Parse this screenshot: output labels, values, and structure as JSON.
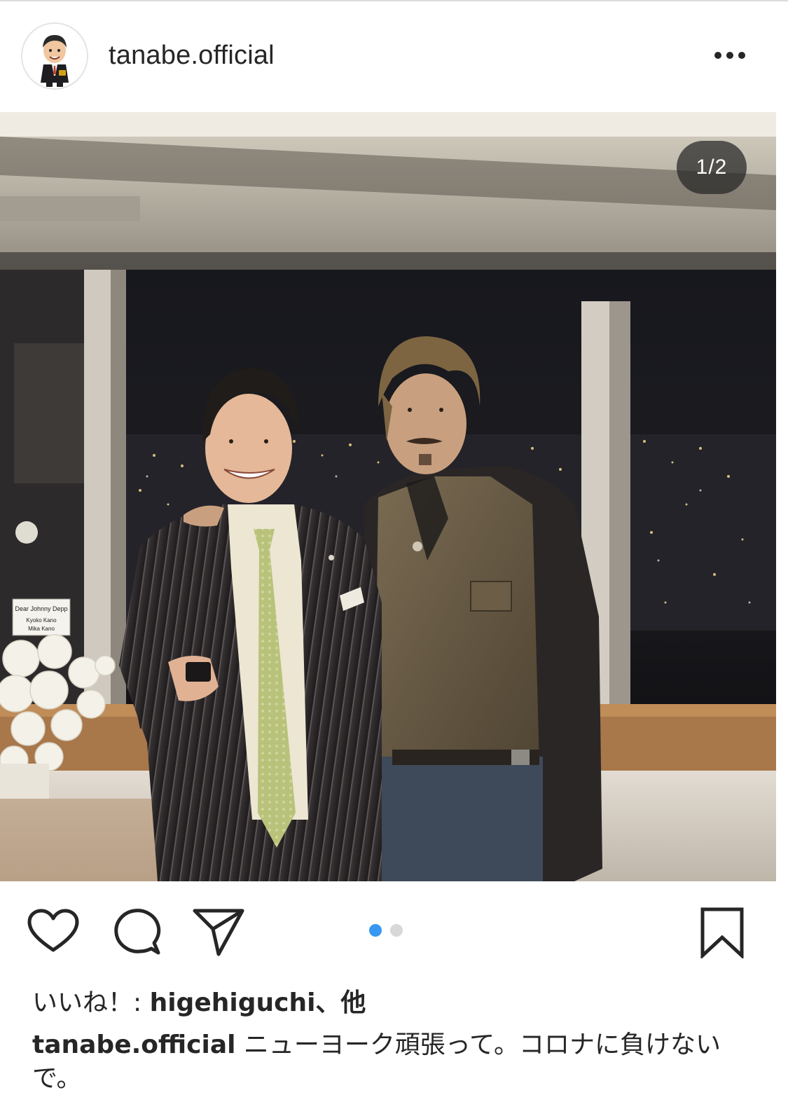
{
  "header": {
    "username": "tanabe.official",
    "avatar_icon": "cartoon-avatar-icon",
    "more_icon": "more-options-icon"
  },
  "photo": {
    "counter": "1/2",
    "card_lines": [
      "Dear Johnny Depp",
      "Kyoko Kano",
      "Mika Kano"
    ]
  },
  "actions": {
    "like_icon": "heart-icon",
    "comment_icon": "comment-bubble-icon",
    "share_icon": "paper-plane-icon",
    "save_icon": "bookmark-icon",
    "carousel": {
      "active_index": 1,
      "total": 2
    },
    "active_dot_color": "#3897f0",
    "inactive_dot_color": "#d8d8d8"
  },
  "likes": {
    "prefix": "いいね！: ",
    "user": "higehiguchi、他"
  },
  "caption": {
    "user": "tanabe.official",
    "text": " ニューヨーク頑張って。コロナに負けないで。"
  }
}
